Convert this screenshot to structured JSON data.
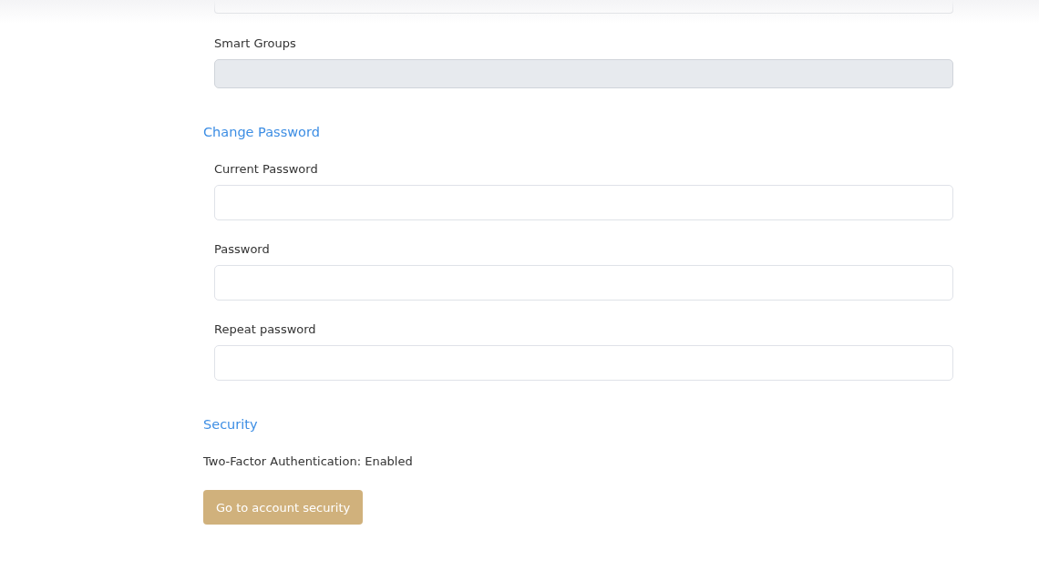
{
  "hierarchy_field": {
    "disabled": false
  },
  "groups_field": {
    "label": "Smart Groups",
    "disabled": true
  },
  "sections": [
    {
      "title": "Change Password",
      "fields": [
        {
          "label": "Current Password",
          "disabled": false
        },
        {
          "label": "Password",
          "disabled": false
        },
        {
          "label": "Repeat password",
          "disabled": false
        }
      ]
    },
    {
      "title": "Security",
      "status": "Two-Factor Authentication: Enabled",
      "button": "Go to account security"
    }
  ]
}
